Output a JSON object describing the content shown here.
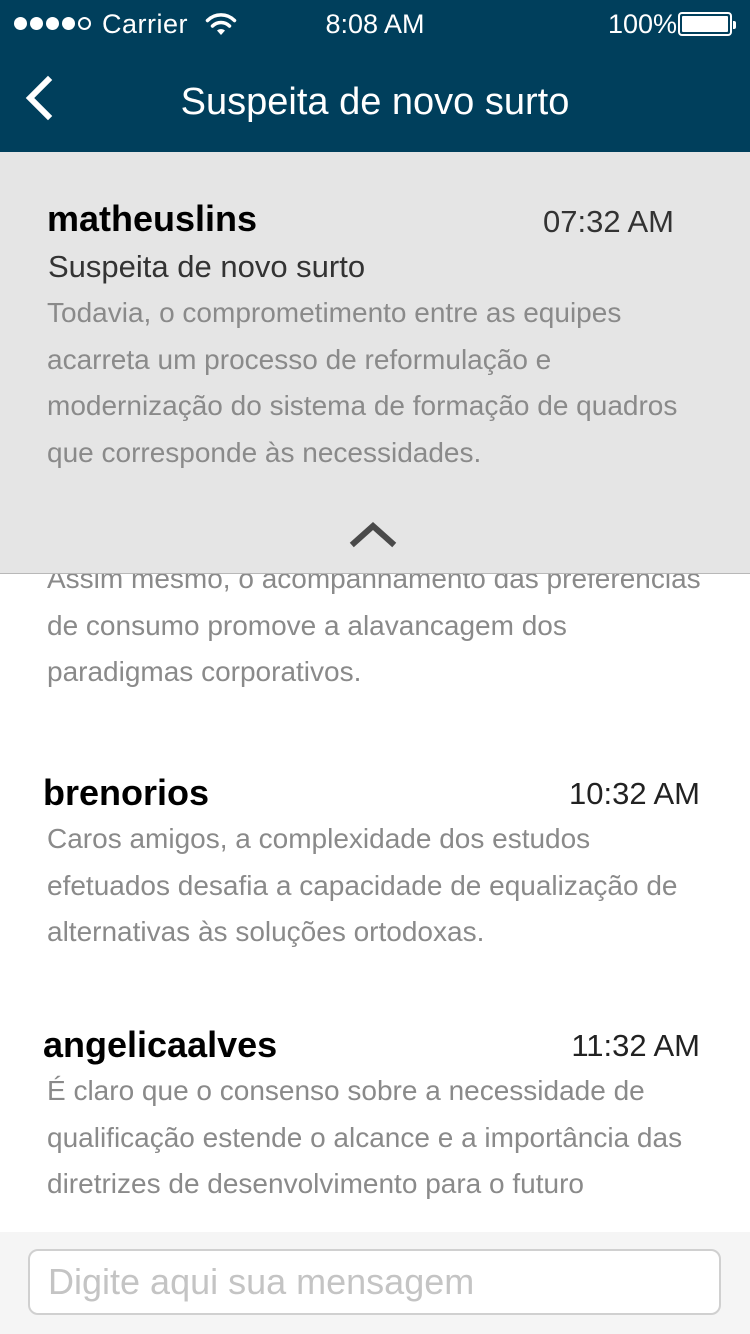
{
  "status_bar": {
    "carrier": "Carrier",
    "time": "8:08 AM",
    "battery": "100%"
  },
  "nav": {
    "title": "Suspeita de novo surto",
    "back_icon": "chevron-left-icon"
  },
  "expanded_message": {
    "author": "matheuslins",
    "time": "07:32 AM",
    "subject": "Suspeita de novo surto",
    "body": "Todavia, o comprometimento entre as equipes acarreta um processo de reformulação e modernização do sistema de formação de quadros que corresponde às necessidades.",
    "collapse_icon": "chevron-up-icon"
  },
  "partial_message": {
    "body": "Assim mesmo, o acompanhamento das preferências de consumo promove a alavancagem dos paradigmas corporativos."
  },
  "messages": [
    {
      "author": "brenorios",
      "time": "10:32 AM",
      "body": "Caros amigos, a complexidade dos estudos efetuados desafia a capacidade de equalização de alternativas às soluções ortodoxas."
    },
    {
      "author": "angelicaalves",
      "time": "11:32 AM",
      "body": "É claro que o consenso sobre a necessidade de qualificação estende o alcance e a importância das diretrizes de desenvolvimento para o futuro"
    }
  ],
  "composer": {
    "placeholder": "Digite aqui sua mensagem"
  }
}
